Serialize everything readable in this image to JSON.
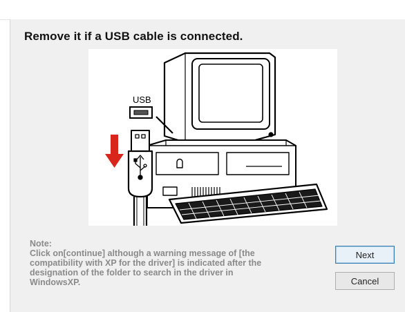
{
  "dialog": {
    "heading": "Remove it if a USB cable is connected.",
    "illustration": {
      "usb_label": "USB",
      "icons": [
        "computer-icon",
        "usb-port-icon",
        "usb-plug-icon",
        "down-arrow-icon",
        "keyboard-icon"
      ],
      "arrow_color": "#d9261c"
    },
    "note": {
      "title": "Note:",
      "lines": [
        "Click on[continue] although a warning message of [the",
        "compatibility with XP for the driver] is indicated after the",
        "designation of the folder to search in the driver in",
        "WindowsXP."
      ]
    },
    "buttons": {
      "next": "Next",
      "cancel": "Cancel"
    }
  }
}
